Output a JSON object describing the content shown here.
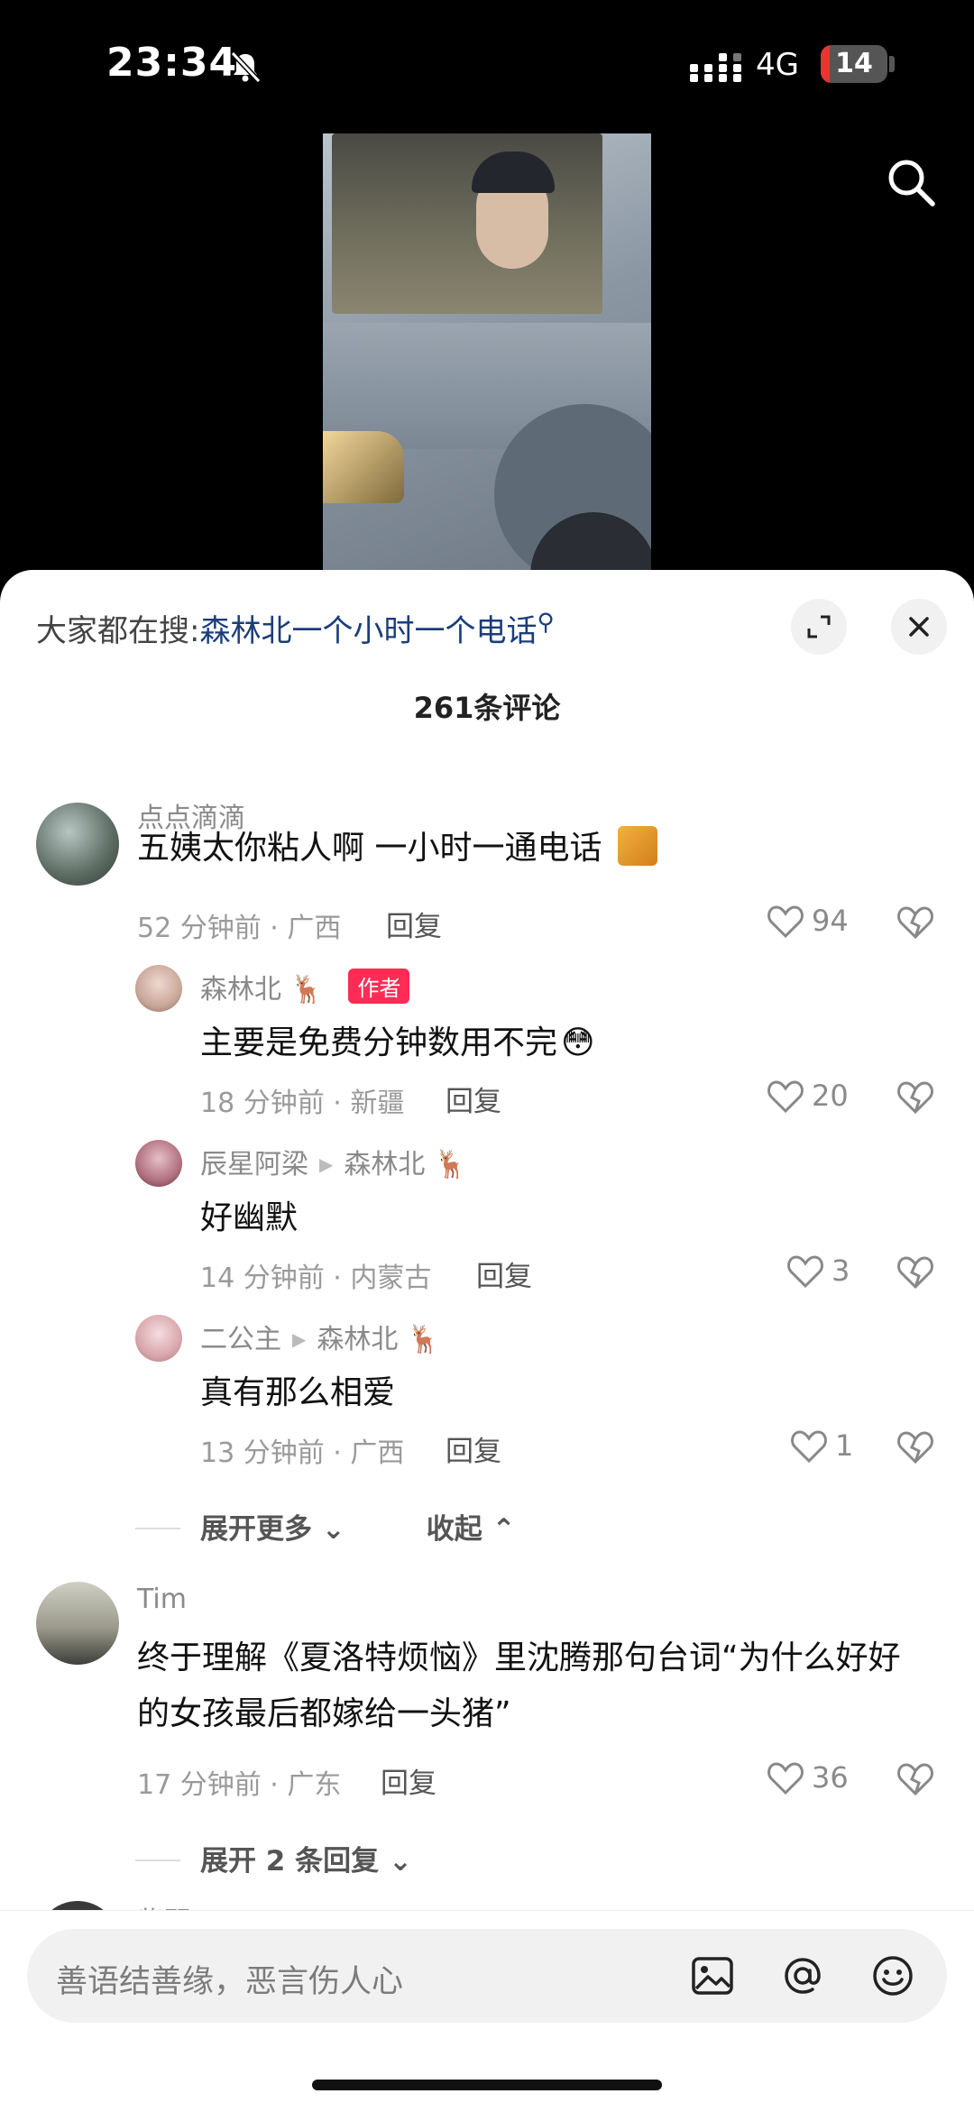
{
  "status": {
    "time": "23:34",
    "network": "4G",
    "battery": "14",
    "battery_level": 0.14
  },
  "sheet": {
    "trending_prefix": "大家都在搜:",
    "trending_query": "森林北一个小时一个电话",
    "comment_count": "261条评论"
  },
  "comments": [
    {
      "user": "点点滴滴",
      "text": "五姨太你粘人啊 一小时一通电话",
      "time_loc": "52 分钟前 · 广西",
      "reply": "回复",
      "likes": "94"
    },
    {
      "user": "森林北",
      "tag": "作者",
      "text": "主要是免费分钟数用不完",
      "time_loc": "18 分钟前 · 新疆",
      "reply": "回复",
      "likes": "20"
    },
    {
      "user": "辰星阿梁",
      "to": "森林北",
      "text": "好幽默",
      "time_loc": "14 分钟前 · 内蒙古",
      "reply": "回复",
      "likes": "3"
    },
    {
      "user": "二公主",
      "to": "森林北",
      "text": "真有那么相爱",
      "time_loc": "13 分钟前 · 广西",
      "reply": "回复",
      "likes": "1"
    },
    {
      "user": "Tim",
      "text": "终于理解《夏洛特烦恼》里沈腾那句台词“为什么好好的女孩最后都嫁给一头猪”",
      "time_loc": "17 分钟前 · 广东",
      "reply": "回复",
      "likes": "36"
    }
  ],
  "expand_more": "展开更多",
  "collapse": "收起",
  "expand_replies": "展开 2 条回复",
  "next_user_partial": "紫羽",
  "input": {
    "placeholder": "善语结善缘，恶言伤人心"
  },
  "colors": {
    "accent": "#fe2c55",
    "link": "#1b3e7a",
    "battery_low": "#e5372f"
  }
}
